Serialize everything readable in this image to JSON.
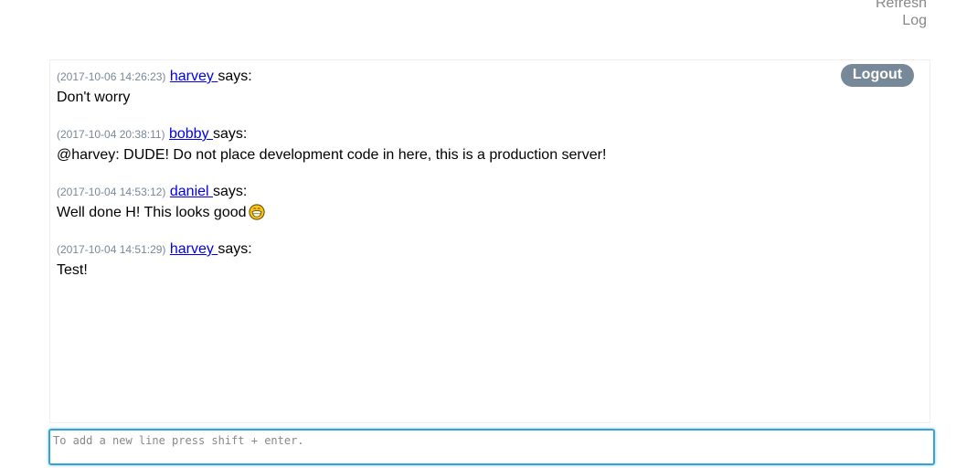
{
  "header": {
    "refresh_label": "Refresh",
    "log_label": "Log"
  },
  "chat": {
    "logout_label": "Logout",
    "says_label": "says:",
    "messages": [
      {
        "timestamp": "(2017-10-06 14:26:23)",
        "user": "harvey",
        "text": "Don't worry"
      },
      {
        "timestamp": "(2017-10-04 20:38:11)",
        "user": "bobby",
        "text": "@harvey: DUDE! Do not place development code in here, this is a production server!"
      },
      {
        "timestamp": "(2017-10-04 14:53:12)",
        "user": "daniel",
        "text": "Well done H! This looks good",
        "emoji": "grinning-face-icon"
      },
      {
        "timestamp": "(2017-10-04 14:51:29)",
        "user": "harvey",
        "text": "Test!"
      }
    ]
  },
  "input": {
    "placeholder": "To add a new line press shift + enter.",
    "value": ""
  },
  "colors": {
    "logout_bg": "#778899",
    "link": "#0000ee",
    "timestamp": "#778899",
    "input_border": "#36a3d5"
  }
}
